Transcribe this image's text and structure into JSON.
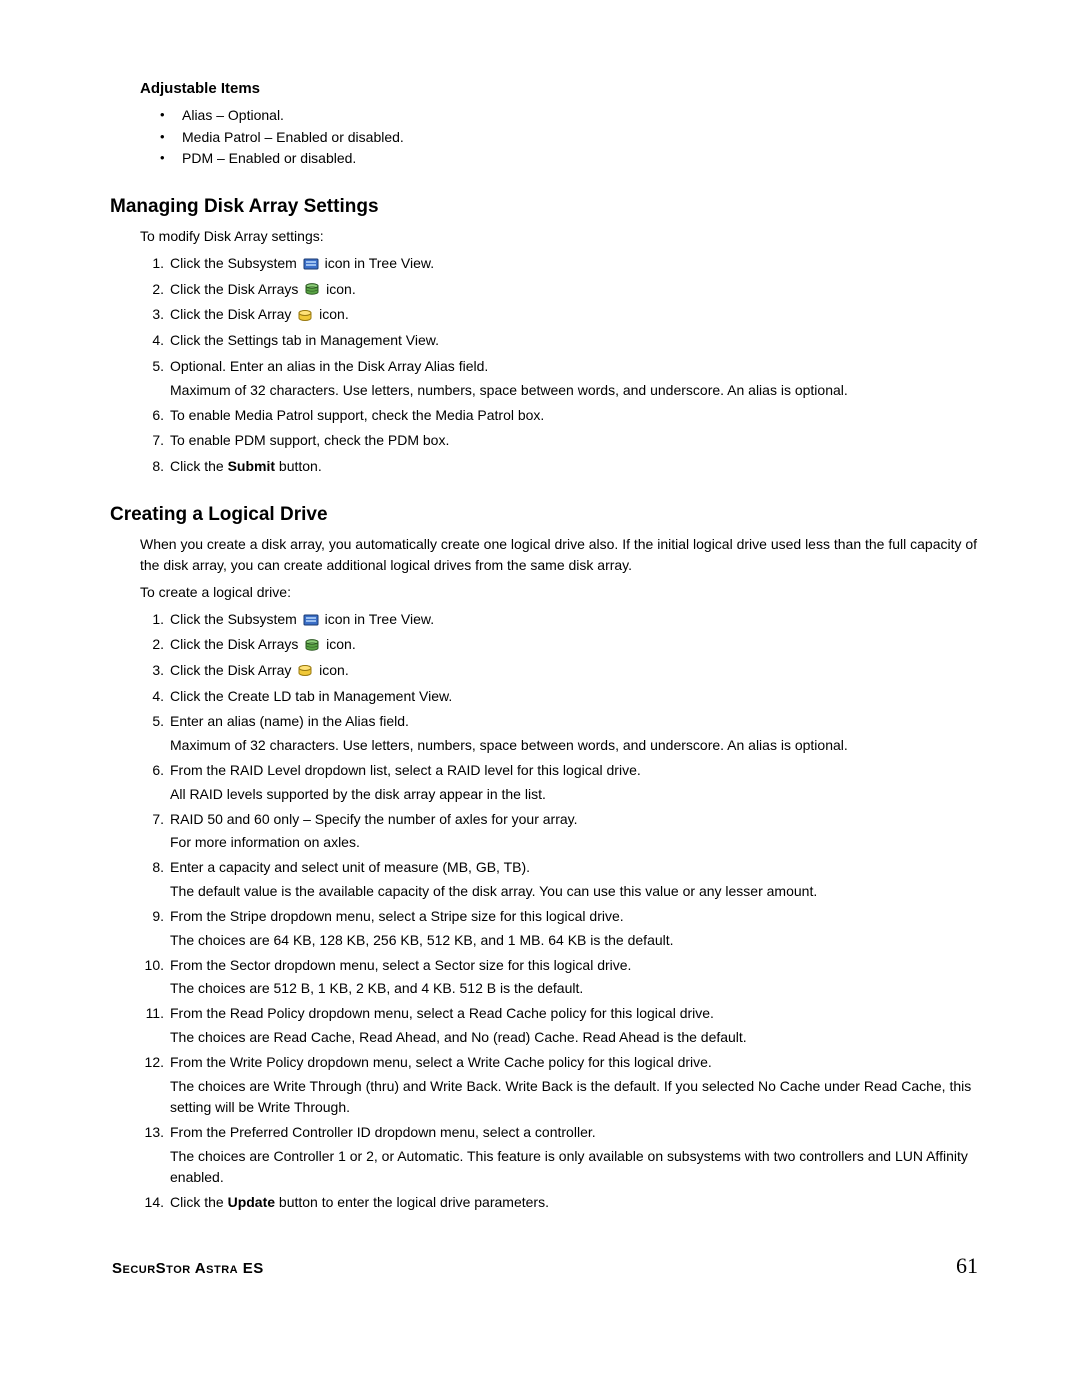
{
  "adjustable": {
    "heading": "Adjustable Items",
    "items": [
      "Alias – Optional.",
      "Media Patrol – Enabled or disabled.",
      "PDM – Enabled or disabled."
    ]
  },
  "section1": {
    "heading": "Managing Disk Array Settings",
    "intro": "To modify Disk Array settings:",
    "steps": [
      {
        "pre": "Click the Subsystem ",
        "icon": "subsystem",
        "post": " icon in Tree View."
      },
      {
        "pre": "Click the Disk Arrays ",
        "icon": "disk-arrays",
        "post": " icon."
      },
      {
        "pre": "Click the Disk Array ",
        "icon": "disk-array",
        "post": " icon."
      },
      {
        "text": "Click the Settings tab in Management View."
      },
      {
        "text": "Optional. Enter an alias in the Disk Array Alias field.",
        "sub": "Maximum of 32 characters. Use letters, numbers, space between words, and underscore. An alias is optional."
      },
      {
        "text": "To enable Media Patrol support, check the Media Patrol box."
      },
      {
        "text": "To enable PDM support, check the PDM box."
      },
      {
        "pre": "Click the ",
        "bold": "Submit",
        "post": " button."
      }
    ]
  },
  "section2": {
    "heading": "Creating a Logical Drive",
    "intro1": "When you create a disk array, you automatically create one logical drive also. If the initial logical drive used less than the full capacity of the disk array, you can create additional logical drives from the same disk array.",
    "intro2": "To create a logical drive:",
    "steps": [
      {
        "pre": "Click the Subsystem ",
        "icon": "subsystem",
        "post": " icon in Tree View."
      },
      {
        "pre": "Click the Disk Arrays ",
        "icon": "disk-arrays",
        "post": " icon."
      },
      {
        "pre": "Click the Disk Array ",
        "icon": "disk-array",
        "post": " icon."
      },
      {
        "text": "Click the Create LD tab in Management View."
      },
      {
        "text": "Enter an alias (name) in the Alias field.",
        "sub": "Maximum of 32 characters. Use letters, numbers, space between words, and underscore. An alias is optional."
      },
      {
        "text": "From the RAID Level dropdown list, select a RAID level for this logical drive.",
        "sub": "All RAID levels supported by the disk array appear in the list."
      },
      {
        "text": "RAID 50 and 60 only – Specify the number of axles for your array.",
        "sub": "For more information on axles."
      },
      {
        "text": "Enter a capacity and select unit of measure (MB, GB, TB).",
        "sub": "The default value is the available capacity of the disk array. You can use this value or any lesser amount."
      },
      {
        "text": "From the Stripe dropdown menu, select a Stripe size for this logical drive.",
        "sub": "The choices are 64 KB, 128 KB, 256 KB, 512 KB, and 1 MB. 64 KB is the default."
      },
      {
        "text": "From the Sector dropdown menu, select a Sector size for this logical drive.",
        "sub": "The choices are 512 B, 1 KB, 2 KB, and 4 KB. 512 B is the default."
      },
      {
        "text": "From the Read Policy dropdown menu, select a Read Cache policy for this logical drive.",
        "sub": "The choices are Read Cache, Read Ahead, and No (read) Cache. Read Ahead is the default."
      },
      {
        "text": "From the Write Policy dropdown menu, select a Write Cache policy for this logical drive.",
        "sub": "The choices are Write Through (thru) and Write Back. Write Back is the default. If you selected No Cache under Read Cache, this setting will be Write Through."
      },
      {
        "text": "From the Preferred Controller ID dropdown menu, select a controller.",
        "sub": "The choices are Controller 1 or 2, or Automatic. This feature is only available on subsystems with two controllers and LUN Affinity enabled."
      },
      {
        "pre": "Click the ",
        "bold": "Update",
        "post": " button to enter the logical drive parameters."
      }
    ]
  },
  "footer": {
    "product": "SecurStor Astra ES",
    "page": "61"
  }
}
